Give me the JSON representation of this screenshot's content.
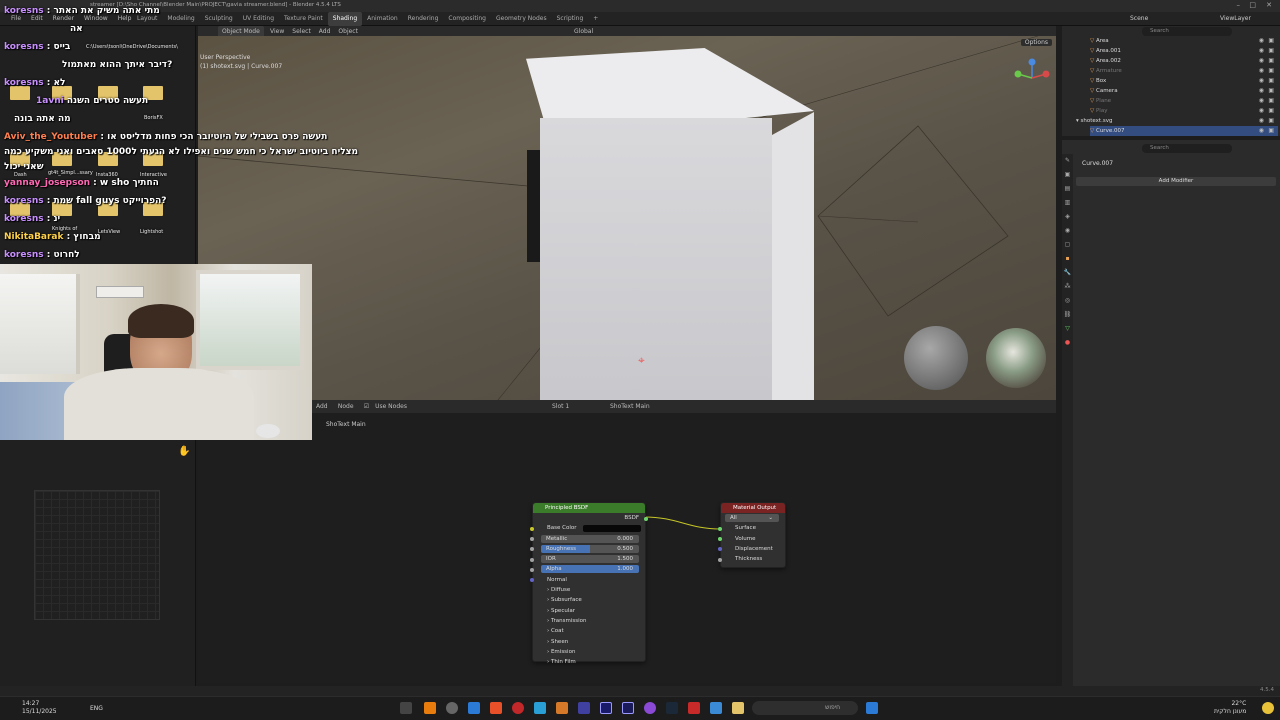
{
  "window": {
    "title": "streamer [D:\\Sho Channel\\Blender Main\\PROJECT\\gavia streamer.blend] - Blender 4.5.4 LTS"
  },
  "menu": [
    "File",
    "Edit",
    "Render",
    "Window",
    "Help"
  ],
  "workspaces": [
    "Layout",
    "Modeling",
    "Sculpting",
    "UV Editing",
    "Texture Paint",
    "Shading",
    "Animation",
    "Rendering",
    "Compositing",
    "Geometry Nodes",
    "Scripting",
    "+"
  ],
  "active_workspace": "Shading",
  "scene": {
    "label": "Scene",
    "view_layer": "ViewLayer"
  },
  "viewport": {
    "mode": "Object Mode",
    "menus": [
      "View",
      "Select",
      "Add",
      "Object"
    ],
    "orientation": "Global",
    "overlay_line1": "User Perspective",
    "overlay_line2": "(1) shotext.svg | Curve.007",
    "options": "Options"
  },
  "chat": [
    {
      "user": "koresns",
      "msg": "מתי אתה משיק את האתר"
    },
    {
      "user": "",
      "msg": "אה"
    },
    {
      "user": "koresns",
      "msg": "בייס"
    },
    {
      "user": "",
      "msg": "דיבר איתך ההוא מאתמול?"
    },
    {
      "user": "koresns",
      "msg": "לא"
    },
    {
      "user": "1avni",
      "msg": "תעשה סטרים השנה"
    },
    {
      "user": "",
      "msg": "מה אתה בונה"
    },
    {
      "user": "Aviv_the_Youtuber",
      "msg": "תעשה פרס בשבילי של היוטיובר הכי פחות מדליסט או"
    },
    {
      "user": "",
      "msg": "מצליח ביוטיוב ישראל כי חמש שנים ואפילו לא הגעתי ל1000 סאבים ואני משקיע כמה"
    },
    {
      "user": "",
      "msg": "שאני יכול"
    },
    {
      "user": "yannay_josepson",
      "msg": "w sho החתיך"
    },
    {
      "user": "koresns",
      "msg": "שמת fall guys הפרוייקט?"
    },
    {
      "user": "koresns",
      "msg": "ינ"
    },
    {
      "user": "NikitaBarak",
      "msg": "מבחוץ"
    },
    {
      "user": "koresns",
      "msg": "לחרוט"
    }
  ],
  "desktop_labels": [
    "C:\\Users\\tsoni\\OneDrive\\Documents\\",
    "BorisFX",
    "Dash",
    "Insta360",
    "Interactive",
    "Knights of",
    "LetsView",
    "Lightshot",
    "gt4t_Simpl...ssary"
  ],
  "node_editor": {
    "menus": [
      "Add",
      "Node"
    ],
    "use_nodes": "Use Nodes",
    "slot": "Slot 1",
    "material": "ShoText Main",
    "breadcrumb": "ShoText Main",
    "bsdf": {
      "title": "Principled BSDF",
      "output": "BSDF",
      "base_color": "Base Color",
      "metallic": {
        "label": "Metallic",
        "value": "0.000"
      },
      "roughness": {
        "label": "Roughness",
        "value": "0.500"
      },
      "ior": {
        "label": "IOR",
        "value": "1.500"
      },
      "alpha": {
        "label": "Alpha",
        "value": "1.000"
      },
      "normal": "Normal",
      "panels": [
        "Diffuse",
        "Subsurface",
        "Specular",
        "Transmission",
        "Coat",
        "Sheen",
        "Emission",
        "Thin Film"
      ]
    },
    "output": {
      "title": "Material Output",
      "target": "All",
      "inputs": [
        "Surface",
        "Volume",
        "Displacement",
        "Thickness"
      ]
    }
  },
  "outliner": {
    "search_placeholder": "Search",
    "items": [
      "Area",
      "Area.001",
      "Area.002",
      "Armature",
      "Box",
      "Camera",
      "Plane",
      "Play",
      "shotext.svg",
      "Curve.007"
    ]
  },
  "properties": {
    "search_placeholder": "Search",
    "object": "Curve.007",
    "add_modifier": "Add Modifier"
  },
  "taskbar": {
    "time": "14:27",
    "date": "15/11/2025",
    "lang": "ENG",
    "search": "חיפוש",
    "weather_temp": "22°C",
    "weather_desc": "מעונן חלקית"
  },
  "status": {
    "version": "4.5.4"
  },
  "colors": {
    "bsdf_header": "#3b7c2a",
    "output_header": "#7a2323",
    "field_blue": "#4772b3",
    "chat_user": "#c890ff"
  }
}
